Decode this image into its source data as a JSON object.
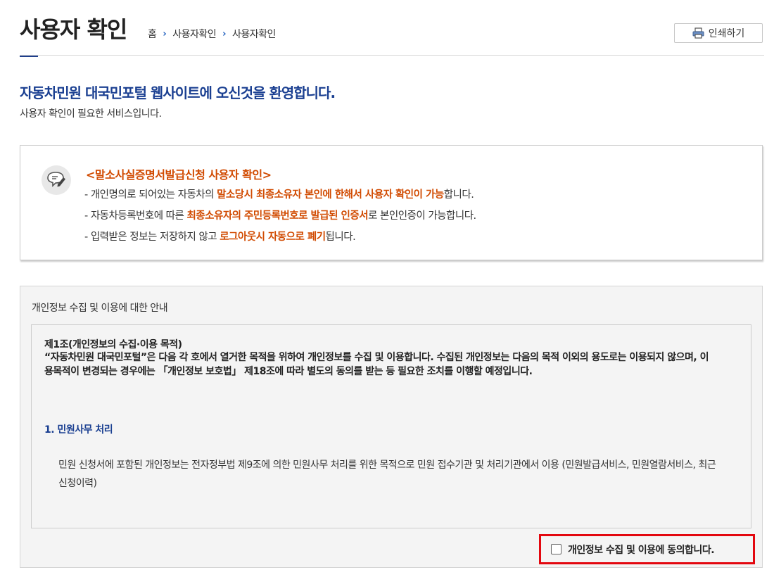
{
  "header": {
    "title": "사용자 확인",
    "breadcrumb": [
      "홈",
      "사용자확인",
      "사용자확인"
    ],
    "breadcrumb_sep": "›",
    "print_label": "인쇄하기",
    "print_icon": "printer-icon"
  },
  "intro": {
    "welcome": "자동차민원 대국민포털 웹사이트에 오신것을 환영합니다.",
    "sub": "사용자 확인이 필요한 서비스입니다."
  },
  "notice": {
    "icon": "pencil-speech-icon",
    "title": "<말소사실증명서발급신청 사용자 확인>",
    "lines": [
      {
        "pre": "- 개인명의로 되어있는 자동차의 ",
        "hl": "말소당시 최종소유자 본인에 한해서 사용자 확인이 가능",
        "post": "합니다."
      },
      {
        "pre": "- 자동차등록번호에 따른 ",
        "hl": "최종소유자의 주민등록번호로 발급된 인증서",
        "post": "로 본인인증이 가능합니다."
      },
      {
        "pre": "- 입력받은 정보는 저장하지 않고 ",
        "hl": "로그아웃시 자동으로 폐기",
        "post": "됩니다."
      }
    ]
  },
  "privacy": {
    "title": "개인정보 수집 및 이용에 대한 안내",
    "article_title": "제1조(개인정보의 수집·이용 목적)",
    "article_body": "“자동차민원 대국민포털”은 다음 각 호에서 열거한 목적을 위하여 개인정보를 수집 및 이용합니다. 수집된 개인정보는 다음의 목적 이외의 용도로는 이용되지 않으며, 이용목적이 변경되는 경우에는 「개인정보 보호법」 제18조에 따라 별도의 동의를 받는 등 필요한 조치를 이행할 예정입니다.",
    "section_title": "1. 민원사무 처리",
    "section_body": "민원 신청서에 포함된 개인정보는 전자정부법 제9조에 의한 민원사무 처리를 위한 목적으로 민원 접수기관 및 처리기관에서 이용 (민원발급서비스, 민원열람서비스, 최근 신청이력)",
    "agree_label": "개인정보 수집 및 이용에 동의합니다.",
    "agree_checked": false
  },
  "colors": {
    "accent_blue": "#1a3f91",
    "highlight_orange": "#d14a00",
    "agree_border_red": "#e3070f"
  }
}
